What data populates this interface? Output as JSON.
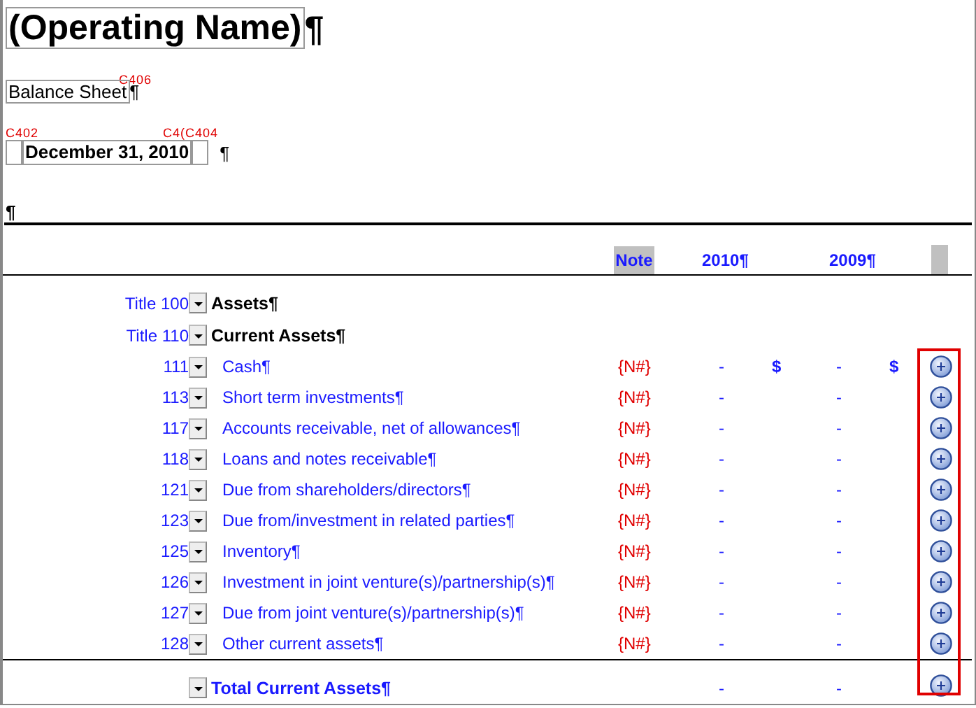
{
  "header": {
    "name": "(Operating Name)",
    "name_mark": "¶",
    "report_code": "C406",
    "report_title": "Balance Sheet",
    "report_mark": "¶",
    "date_codes": [
      "C402",
      "C4(C404"
    ],
    "date": "December 31, 2010",
    "date_mark": "¶",
    "blank_mark": "¶"
  },
  "columns": {
    "note": "Note",
    "year_1": "2010¶",
    "year_2": "2009¶"
  },
  "rows": [
    {
      "kind": "title",
      "code": "Title 100",
      "label": "Assets¶"
    },
    {
      "kind": "title",
      "code": "Title 110",
      "label": "Current Assets¶"
    },
    {
      "kind": "item",
      "code": "111",
      "label": "Cash¶",
      "note": "{N#}",
      "amounts": [
        {
          "dash": "-",
          "sign": "$"
        },
        {
          "dash": "-",
          "sign": "$"
        }
      ]
    },
    {
      "kind": "item",
      "code": "113",
      "label": "Short term investments¶",
      "note": "{N#}",
      "amounts": [
        {
          "dash": "-"
        },
        {
          "dash": "-"
        }
      ]
    },
    {
      "kind": "item",
      "code": "117",
      "label": "Accounts receivable, net of allowances¶",
      "note": "{N#}",
      "amounts": [
        {
          "dash": "-"
        },
        {
          "dash": "-"
        }
      ]
    },
    {
      "kind": "item",
      "code": "118",
      "label": "Loans and notes receivable¶",
      "note": "{N#}",
      "amounts": [
        {
          "dash": "-"
        },
        {
          "dash": "-"
        }
      ]
    },
    {
      "kind": "item",
      "code": "121",
      "label": "Due from shareholders/directors¶",
      "note": "{N#}",
      "amounts": [
        {
          "dash": "-"
        },
        {
          "dash": "-"
        }
      ]
    },
    {
      "kind": "item",
      "code": "123",
      "label": "Due from/investment in related parties¶",
      "note": "{N#}",
      "amounts": [
        {
          "dash": "-"
        },
        {
          "dash": "-"
        }
      ]
    },
    {
      "kind": "item",
      "code": "125",
      "label": "Inventory¶",
      "note": "{N#}",
      "amounts": [
        {
          "dash": "-"
        },
        {
          "dash": "-"
        }
      ]
    },
    {
      "kind": "item",
      "code": "126",
      "label": "Investment in joint venture(s)/partnership(s)¶",
      "note": "{N#}",
      "amounts": [
        {
          "dash": "-"
        },
        {
          "dash": "-"
        }
      ]
    },
    {
      "kind": "item",
      "code": "127",
      "label": "Due from joint venture(s)/partnership(s)¶",
      "note": "{N#}",
      "amounts": [
        {
          "dash": "-"
        },
        {
          "dash": "-"
        }
      ]
    },
    {
      "kind": "item",
      "code": "128",
      "label": "Other current assets¶",
      "note": "{N#}",
      "amounts": [
        {
          "dash": "-"
        },
        {
          "dash": "-"
        }
      ]
    },
    {
      "kind": "total",
      "label": "Total Current Assets¶",
      "amounts": [
        {
          "dash": "-"
        },
        {
          "dash": "-"
        }
      ]
    }
  ]
}
